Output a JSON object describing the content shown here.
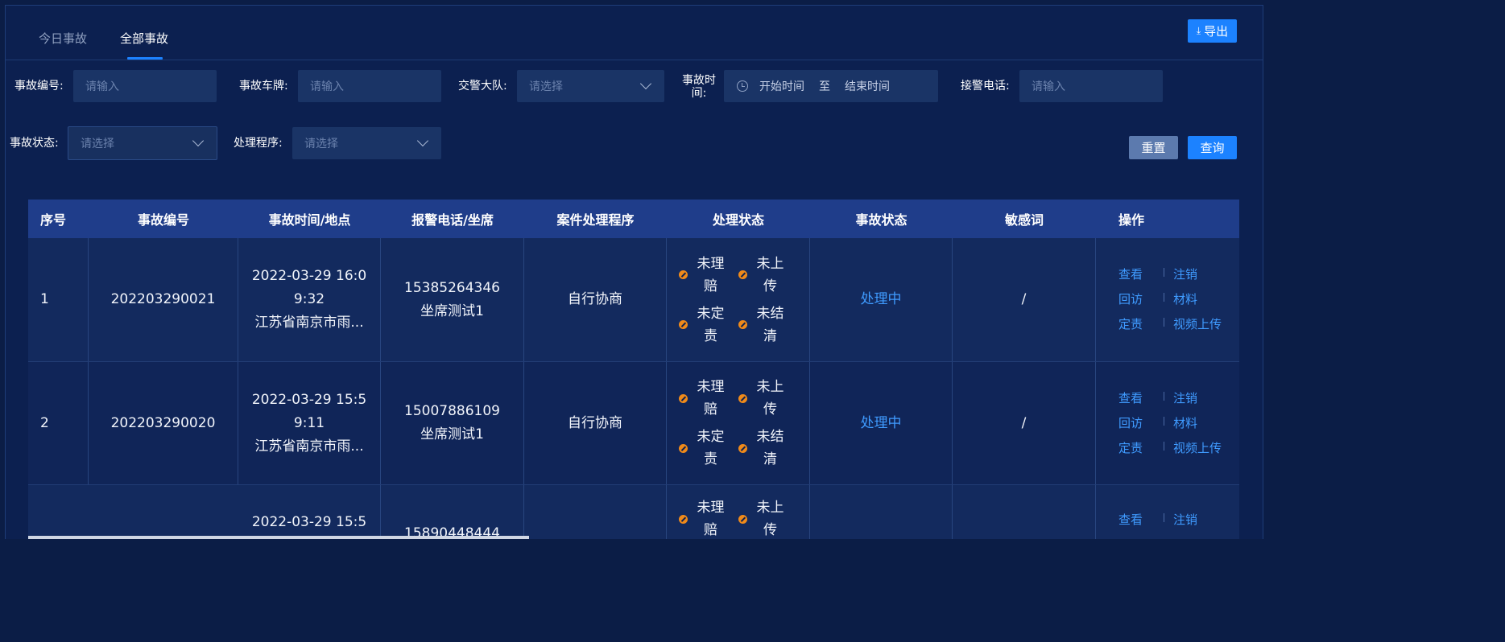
{
  "tabs": [
    {
      "label": "今日事故"
    },
    {
      "label": "全部事故"
    }
  ],
  "export_label": "导出",
  "filters": {
    "accident_no": {
      "label": "事故编号:",
      "placeholder": "请输入"
    },
    "plate": {
      "label": "事故车牌:",
      "placeholder": "请输入"
    },
    "police_team": {
      "label": "交警大队:",
      "placeholder": "请选择"
    },
    "accident_time": {
      "label": "事故时间:",
      "start": "开始时间",
      "sep": "至",
      "end": "结束时间"
    },
    "phone": {
      "label": "接警电话:",
      "placeholder": "请输入"
    },
    "accident_status": {
      "label": "事故状态:",
      "placeholder": "请选择"
    },
    "procedure": {
      "label": "处理程序:",
      "placeholder": "请选择"
    },
    "reset_label": "重置",
    "query_label": "查询"
  },
  "table": {
    "columns": [
      "序号",
      "事故编号",
      "事故时间/地点",
      "报警电话/坐席",
      "案件处理程序",
      "处理状态",
      "事故状态",
      "敏感词",
      "操作"
    ],
    "rows": [
      {
        "index": "1",
        "no": "202203290021",
        "time_a": "2022-03-29 16:0",
        "time_b": "9:32",
        "place": "江苏省南京市雨...",
        "phone": "15385264346",
        "seat": "坐席测试1",
        "procedure": "自行协商",
        "statuses": [
          {
            "a": "未理",
            "b": "赔"
          },
          {
            "a": "未上",
            "b": "传"
          },
          {
            "a": "未定",
            "b": "责"
          },
          {
            "a": "未结",
            "b": "清"
          }
        ],
        "accident_status": "处理中",
        "sensitive": "/",
        "ops": [
          "查看",
          "注销",
          "回访",
          "材料",
          "定责",
          "视频上传"
        ]
      },
      {
        "index": "2",
        "no": "202203290020",
        "time_a": "2022-03-29 15:5",
        "time_b": "9:11",
        "place": "江苏省南京市雨...",
        "phone": "15007886109",
        "seat": "坐席测试1",
        "procedure": "自行协商",
        "statuses": [
          {
            "a": "未理",
            "b": "赔"
          },
          {
            "a": "未上",
            "b": "传"
          },
          {
            "a": "未定",
            "b": "责"
          },
          {
            "a": "未结",
            "b": "清"
          }
        ],
        "accident_status": "处理中",
        "sensitive": "/",
        "ops": [
          "查看",
          "注销",
          "回访",
          "材料",
          "定责",
          "视频上传"
        ]
      },
      {
        "index": "",
        "no": "",
        "time_a": "2022-03-29 15:5",
        "time_b": "",
        "place": "",
        "phone": "15890448444",
        "seat": "",
        "procedure": "",
        "statuses": [
          {
            "a": "未理",
            "b": "赔"
          },
          {
            "a": "未上",
            "b": "传"
          }
        ],
        "accident_status": "",
        "sensitive": "",
        "ops": [
          "查看",
          "注销"
        ]
      }
    ]
  }
}
